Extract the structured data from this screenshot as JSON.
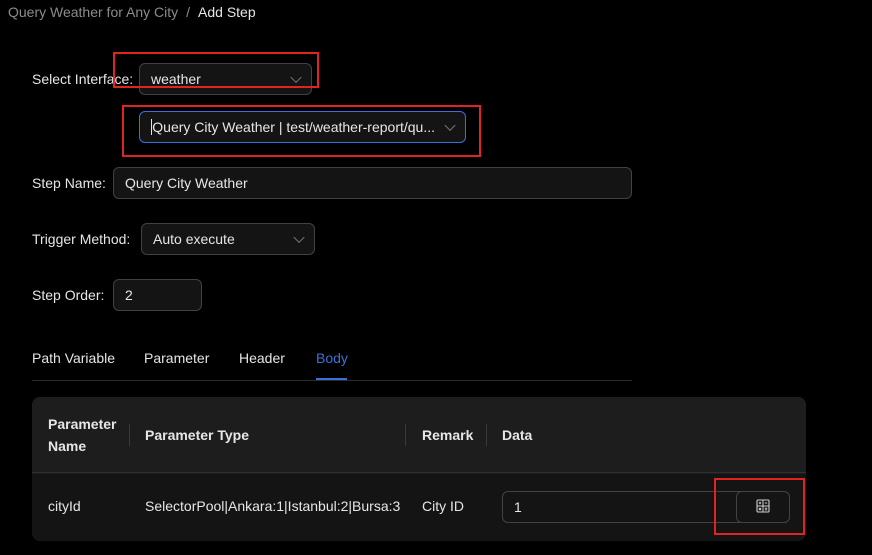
{
  "breadcrumb": {
    "parent": "Query Weather for Any City",
    "separator": "/",
    "current": "Add Step"
  },
  "form": {
    "select_interface_label": "Select Interface",
    "interface_group_value": "weather",
    "interface_value": "Query City Weather | test/weather-report/qu...",
    "step_name_label": "Step Name",
    "step_name_value": "Query City Weather",
    "trigger_method_label": "Trigger Method",
    "trigger_method_value": "Auto execute",
    "step_order_label": "Step Order",
    "step_order_value": "2",
    "colon": ":"
  },
  "tabs": [
    {
      "label": "Path Variable",
      "active": false
    },
    {
      "label": "Parameter",
      "active": false
    },
    {
      "label": "Header",
      "active": false
    },
    {
      "label": "Body",
      "active": true
    }
  ],
  "table": {
    "headers": {
      "name_line1": "Parameter",
      "name_line2": "Name",
      "type": "Parameter Type",
      "remark": "Remark",
      "data": "Data"
    },
    "rows": [
      {
        "name": "cityId",
        "type": "SelectorPool|Ankara:1|Istanbul:2|Bursa:3",
        "remark": "City ID",
        "data": "1"
      }
    ]
  },
  "icons": {
    "calculator": "calculator-icon",
    "chevron": "chevron-down-icon"
  },
  "colors": {
    "background": "#000000",
    "accent": "#3c6fd8",
    "highlight_box": "#e02424"
  }
}
